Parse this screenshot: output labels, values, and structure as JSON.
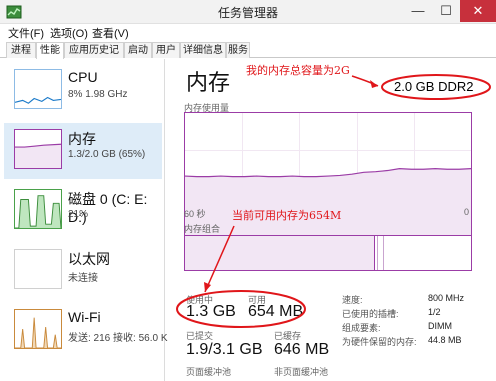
{
  "window": {
    "title": "任务管理器",
    "minimize": "—",
    "maximize": "☐",
    "close": "✕"
  },
  "menu": [
    "文件(F)",
    "选项(O)",
    "查看(V)"
  ],
  "tabs": [
    "进程",
    "性能",
    "应用历史记录",
    "启动",
    "用户",
    "详细信息",
    "服务"
  ],
  "active_tab": "性能",
  "sidebar": [
    {
      "name": "CPU",
      "sub": "8% 1.98 GHz"
    },
    {
      "name": "内存",
      "sub": "1.3/2.0 GB (65%)"
    },
    {
      "name": "磁盘 0 (C: E: D:)",
      "sub": "21%"
    },
    {
      "name": "以太网",
      "sub": "未连接"
    },
    {
      "name": "Wi-Fi",
      "sub": "发送: 216 接收: 56.0 K"
    }
  ],
  "memory": {
    "title": "内存",
    "capacity": "2.0 GB DDR2",
    "graph_label": "内存使用量",
    "axis_left": "60 秒",
    "axis_right": "0",
    "composition_label": "内存组合",
    "usage_fraction": 0.65
  },
  "stats": {
    "in_use_label": "使用中",
    "in_use_value": "1.3 GB",
    "available_label": "可用",
    "available_value": "654 MB",
    "committed_label": "已提交",
    "committed_value": "1.9/3.1 GB",
    "cached_label": "已缓存",
    "cached_value": "646 MB",
    "paged_label": "页面缓冲池",
    "nonpaged_label": "非页面缓冲池"
  },
  "details": [
    {
      "label": "速度:",
      "value": "800 MHz"
    },
    {
      "label": "已使用的插槽:",
      "value": "1/2"
    },
    {
      "label": "组成要素:",
      "value": "DIMM"
    },
    {
      "label": "为硬件保留的内存:",
      "value": "44.8 MB"
    }
  ],
  "annotations": {
    "total": "我的内存总容量为2G",
    "available": "当前可用内存为654M"
  },
  "colors": {
    "accent": "#9b3ca6",
    "annotation": "#e0161a",
    "selected": "#deecf8"
  }
}
